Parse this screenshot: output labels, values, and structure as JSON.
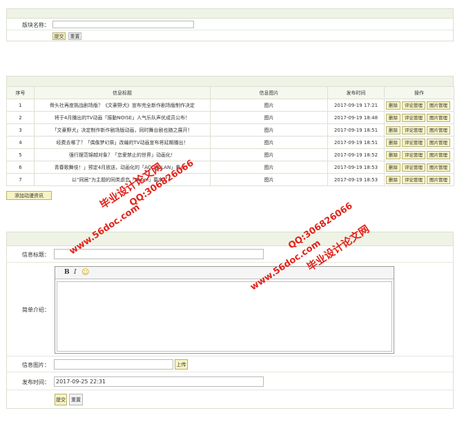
{
  "block_form": {
    "label": "版块名称：",
    "name_value": "",
    "submit_label": "提交",
    "reset_label": "重置"
  },
  "news_table": {
    "headers": [
      "序号",
      "信息标题",
      "信息图片",
      "发布时间",
      "操作"
    ],
    "rows": [
      {
        "no": "1",
        "title": "骨头社再度挑战剧场版？《文豪野犬》宣布完全新作剧场版制作决定",
        "image": "图片",
        "time": "2017-09-19 17:21"
      },
      {
        "no": "2",
        "title": "将于4月播出的TV动画「振動NOISE」人气乐队声优成员公布！",
        "image": "图片",
        "time": "2017-09-19 18:48"
      },
      {
        "no": "3",
        "title": "「文豪野犬」决定制作新作剧场版动画，同时舞台剧也随之展开！",
        "image": "图片",
        "time": "2017-09-19 18:51"
      },
      {
        "no": "4",
        "title": "经费去哪了？「偶像梦幻祭」改编的TV动画宣布将延期播出！",
        "image": "图片",
        "time": "2017-09-19 18:51"
      },
      {
        "no": "5",
        "title": "强行摆范锦越对象？「恋爱禁止的世界」动画化！",
        "image": "图片",
        "time": "2017-09-19 18:52"
      },
      {
        "no": "6",
        "title": "青春歌舞伎！」预定4月放送，动画化的「ACCACLAN」看点！",
        "image": "图片",
        "time": "2017-09-19 18:53"
      },
      {
        "no": "7",
        "title": "以“同居”为主题的同类虐恋「Room」要来了！",
        "image": "图片",
        "time": "2017-09-19 18:53"
      }
    ],
    "ops": {
      "delete": "删除",
      "comments": "评论管理",
      "images": "图片管理"
    }
  },
  "add_button_label": "添加动漫资讯",
  "news_form": {
    "title_label": "信息标题：",
    "title_value": "",
    "intro_label": "简单介绍：",
    "editor_bold": "B",
    "editor_italic": "I",
    "editor_emoji": "☺",
    "intro_value": "",
    "image_label": "信息图片：",
    "image_value": "",
    "upload_label": "上传",
    "time_label": "发布时间：",
    "time_value": "2017-09-25 22:31",
    "submit_label": "提交",
    "reset_label": "重置"
  },
  "watermarks": {
    "site": "www.56doc.com",
    "qq": "QQ:306826066",
    "name": "毕业设计论文网"
  }
}
